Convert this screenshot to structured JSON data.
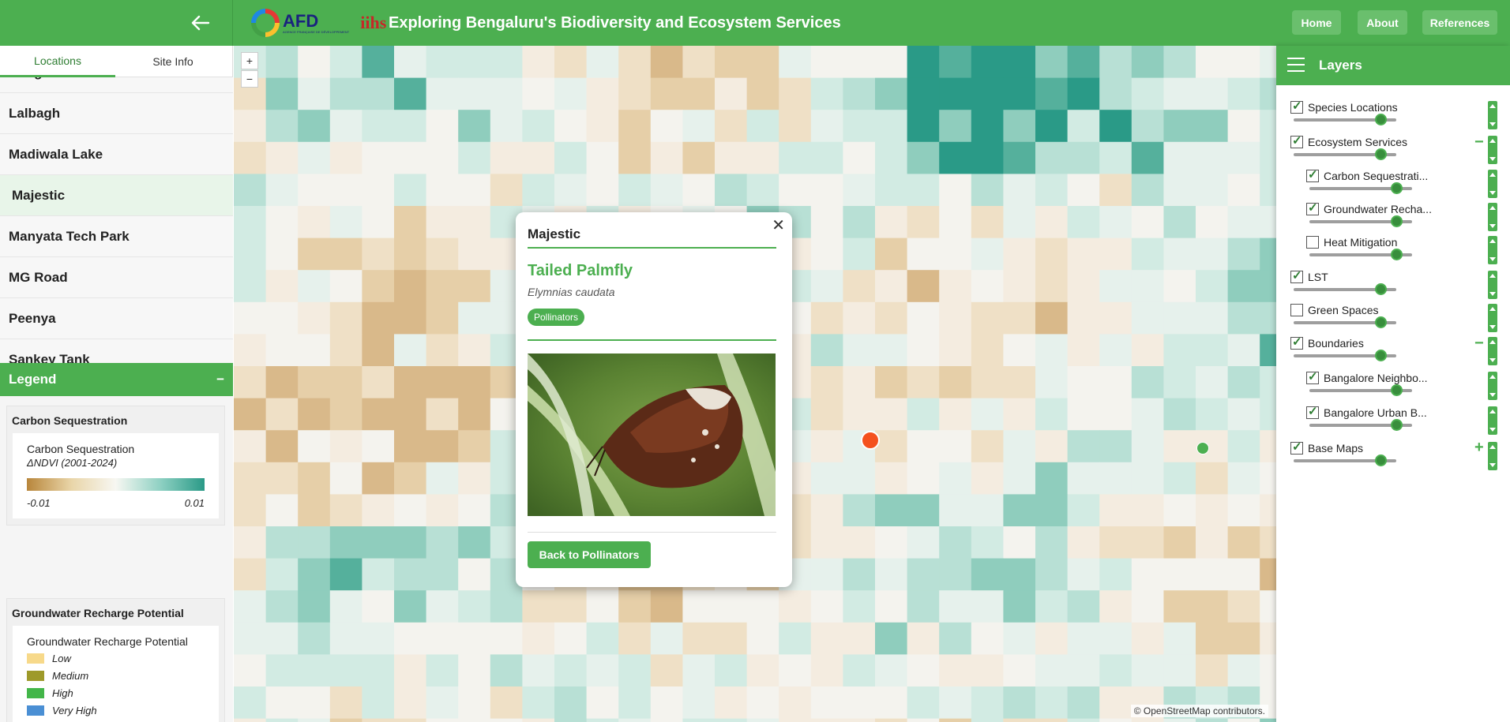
{
  "header": {
    "title": "Exploring Bengaluru's Biodiversity and Ecosystem Services",
    "logo_afd": "AFD",
    "logo_afd_sub": "AGENCE FRANÇAISE DE DÉVELOPPEMENT",
    "logo_iihs": "iihs",
    "nav": [
      "Home",
      "About",
      "References"
    ]
  },
  "sidebar": {
    "tabs": [
      "Locations",
      "Site Info"
    ],
    "active_tab": "Locations",
    "locations": [
      "Rengeri Lake",
      "Lalbagh",
      "Madiwala Lake",
      "Majestic",
      "Manyata Tech Park",
      "MG Road",
      "Peenya",
      "Sankey Tank"
    ],
    "active_location": "Majestic"
  },
  "legend": {
    "title": "Legend",
    "collapse_symbol": "−",
    "carbon": {
      "section_title": "Carbon Sequestration",
      "name": "Carbon Sequestration",
      "subtitle": "ΔNDVI (2001-2024)",
      "min": "-0.01",
      "max": "0.01",
      "colors": [
        "#b8863b",
        "#e9d5a8",
        "#f7f7f2",
        "#8fd1c3",
        "#2a9a87"
      ]
    },
    "groundwater": {
      "section_title": "Groundwater Recharge Potential",
      "name": "Groundwater Recharge Potential",
      "classes": [
        {
          "label": "Low",
          "color": "#f7d98a"
        },
        {
          "label": "Medium",
          "color": "#9e9a2a"
        },
        {
          "label": "High",
          "color": "#43b649"
        },
        {
          "label": "Very High",
          "color": "#4a8fd4"
        }
      ]
    }
  },
  "map": {
    "zoom_in": "+",
    "zoom_out": "−",
    "attribution_symbol": "©",
    "attribution_link": "OpenStreetMap",
    "attribution_rest": " contributors."
  },
  "popup": {
    "close": "✕",
    "site": "Majestic",
    "common_name": "Tailed Palmfly",
    "scientific_name": "Elymnias caudata",
    "tag": "Pollinators",
    "back_button": "Back to Pollinators"
  },
  "layers": {
    "title": "Layers",
    "items": [
      {
        "label": "Species Locations",
        "checked": true,
        "opacity": 0.85
      },
      {
        "label": "Ecosystem Services",
        "checked": true,
        "opacity": 0.85,
        "toggle": "−"
      },
      {
        "label": "Carbon Sequestrati...",
        "checked": true,
        "opacity": 0.85
      },
      {
        "label": "Groundwater Recha...",
        "checked": true,
        "opacity": 0.85
      },
      {
        "label": "Heat Mitigation",
        "checked": false,
        "opacity": 0.85
      },
      {
        "label": "LST",
        "checked": true,
        "opacity": 0.85
      },
      {
        "label": "Green Spaces",
        "checked": false,
        "opacity": 0.85
      },
      {
        "label": "Boundaries",
        "checked": true,
        "opacity": 0.85,
        "toggle": "−"
      },
      {
        "label": "Bangalore Neighbo...",
        "checked": true,
        "opacity": 0.85
      },
      {
        "label": "Bangalore Urban B...",
        "checked": true,
        "opacity": 0.85
      },
      {
        "label": "Base Maps",
        "checked": true,
        "opacity": 0.85,
        "toggle": "+"
      }
    ]
  }
}
